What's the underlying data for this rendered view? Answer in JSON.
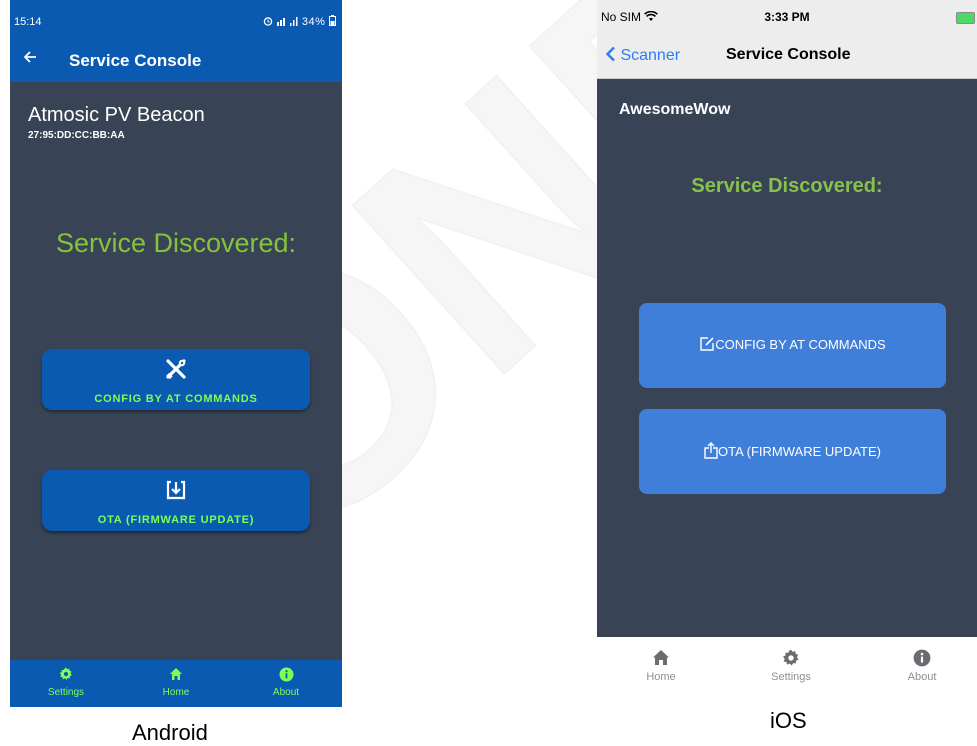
{
  "android": {
    "status_bar": {
      "time": "15:14",
      "indicators": "⏰ ⦁ ┃ 34%",
      "battery_text": "34%"
    },
    "app_bar": {
      "back_icon": "arrow-left-icon",
      "title": "Service Console"
    },
    "device": {
      "name": "Atmosic PV Beacon",
      "mac": "27:95:DD:CC:BB:AA"
    },
    "discovered_label": "Service Discovered:",
    "buttons": [
      {
        "label": "CONFIG BY AT COMMANDS",
        "icon": "tools-icon"
      },
      {
        "label": "OTA (FIRMWARE UPDATE)",
        "icon": "download-box-icon"
      }
    ],
    "bottom_nav": [
      {
        "label": "Settings",
        "icon": "gear-icon"
      },
      {
        "label": "Home",
        "icon": "home-icon"
      },
      {
        "label": "About",
        "icon": "info-icon"
      }
    ],
    "caption": "Android",
    "colors": {
      "bar": "#0b5ab2",
      "background": "#384456",
      "accent": "#86c23a",
      "button_text": "#7cff55"
    }
  },
  "ios": {
    "status_bar": {
      "carrier": "No SIM",
      "time": "3:33 PM"
    },
    "nav_bar": {
      "back_label": "Scanner",
      "title": "Service Console"
    },
    "device": {
      "name": "AwesomeWow"
    },
    "discovered_label": "Service Discovered:",
    "buttons": [
      {
        "label": "CONFIG BY AT COMMANDS",
        "icon": "edit-icon"
      },
      {
        "label": "OTA (FIRMWARE UPDATE)",
        "icon": "share-icon"
      }
    ],
    "tab_bar": [
      {
        "label": "Home",
        "icon": "home-icon"
      },
      {
        "label": "Settings",
        "icon": "gear-icon"
      },
      {
        "label": "About",
        "icon": "info-icon"
      }
    ],
    "caption": "iOS",
    "colors": {
      "nav": "#ededee",
      "background": "#384456",
      "accent": "#86c14d",
      "button": "#3f7fd9",
      "link": "#2d7cf6"
    }
  }
}
